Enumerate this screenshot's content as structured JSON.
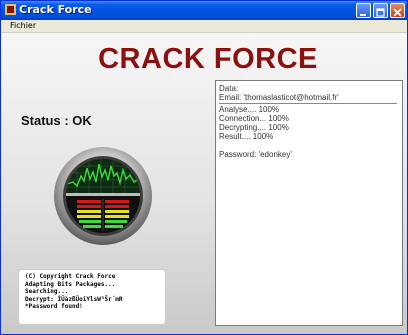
{
  "window": {
    "title": "Crack Force"
  },
  "menu": {
    "items": [
      "Fichier"
    ]
  },
  "header": {
    "title": "CRACK FORCE"
  },
  "status": {
    "text": "Status : OK"
  },
  "console": {
    "lines": [
      "(C) Copyright Crack Force",
      "Adapting Bits Packages...",
      "Searching...",
      "Decrypt: ÌÜàzßÜoiYlsW³Šr´mR",
      "*Password found!"
    ]
  },
  "output": {
    "data_label": "Data:",
    "email_line": "Email: 'thomaslasticot@hotmail.fr'",
    "progress_lines": [
      "Analyse.... 100%",
      "Connection... 100%",
      "Decrypting.... 100%",
      "Result.... 100%"
    ],
    "password_line": "Password: 'edonkey'"
  },
  "colors": {
    "title_accent": "#8b1010",
    "titlebar": "#0053e1",
    "gauge_green": "#3bdc3b",
    "gauge_red": "#d81818",
    "gauge_yellow": "#e8e020"
  },
  "icons": [
    "app-icon",
    "minimize-icon",
    "maximize-icon",
    "close-icon",
    "signal-gauge-icon"
  ]
}
